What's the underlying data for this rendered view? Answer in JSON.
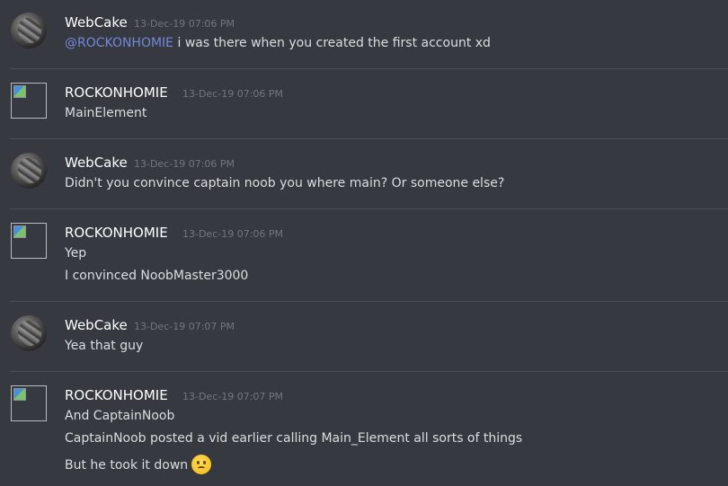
{
  "messages": [
    {
      "author": "WebCake",
      "timestamp": "13-Dec-19 07:06 PM",
      "avatar": "round-avatar",
      "mention": "@ROCKONHOMIE",
      "lines": [
        "i was there when you created the first account xd"
      ]
    },
    {
      "author": "ROCKONHOMIE",
      "timestamp": "13-Dec-19 07:06 PM",
      "avatar": "broken-image-icon",
      "lines": [
        "MainElement"
      ]
    },
    {
      "author": "WebCake",
      "timestamp": "13-Dec-19 07:06 PM",
      "avatar": "round-avatar",
      "lines": [
        "Didn't you convince captain noob you where main? Or someone else?"
      ]
    },
    {
      "author": "ROCKONHOMIE",
      "timestamp": "13-Dec-19 07:06 PM",
      "avatar": "broken-image-icon",
      "lines": [
        "Yep",
        "I convinced NoobMaster3000"
      ]
    },
    {
      "author": "WebCake",
      "timestamp": "13-Dec-19 07:07 PM",
      "avatar": "round-avatar",
      "lines": [
        "Yea that guy"
      ]
    },
    {
      "author": "ROCKONHOMIE",
      "timestamp": "13-Dec-19 07:07 PM",
      "avatar": "broken-image-icon",
      "lines": [
        "And CaptainNoob",
        "CaptainNoob posted a vid earlier calling Main_Element all sorts of things",
        "But he took it down"
      ],
      "emoji": "frowning-face-emoji"
    }
  ],
  "colors": {
    "background": "#36393f",
    "username": "#ffffff",
    "timestamp": "#72767d",
    "text": "#dcddde",
    "mention": "#7289da",
    "divider": "#494c52"
  }
}
